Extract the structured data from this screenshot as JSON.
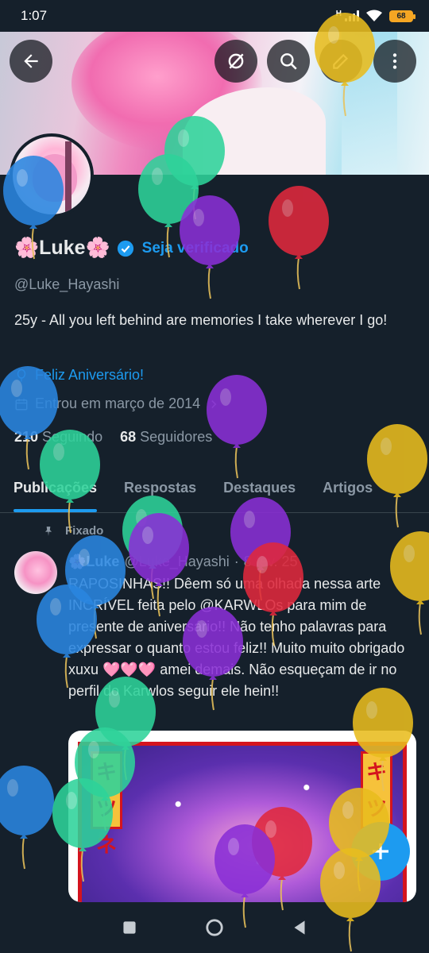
{
  "status_bar": {
    "time": "1:07",
    "network": "H",
    "battery": "68"
  },
  "header": {
    "back_icon": "arrow-left-icon",
    "actions": [
      "circle-slash-icon",
      "search-icon",
      "edit-icon",
      "more-vertical-icon"
    ]
  },
  "profile": {
    "name": "Luke",
    "name_decoration": "🌸",
    "verified_cta": "Seja verificado",
    "handle": "@Luke_Hayashi",
    "bio": "25y - All you left behind are memories I take wherever I go!",
    "birthday": "Feliz Aniversário!",
    "joined": "Entrou em março de 2014",
    "following_count": "210",
    "following_label": "Seguindo",
    "followers_count": "68",
    "followers_label": "Seguidores"
  },
  "tabs": [
    {
      "label": "Publicações",
      "active": true
    },
    {
      "label": "Respostas",
      "active": false
    },
    {
      "label": "Destaques",
      "active": false
    },
    {
      "label": "Artigos",
      "active": false
    }
  ],
  "pinned_post": {
    "pinned_label": "Fixado",
    "author_name": "Luke",
    "author_handle": "@Luke_Hayashi",
    "separator": "·",
    "date": "8 fev. 25",
    "text": "RAPOSINHAS!! Dêem só uma olhada nessa arte INCRÍVEL feita pelo @KARWLOs para mim de presente de aniversário!! Não tenho palavras para expressar o quanto estou feliz!! Muito muito obrigado xuxu 🩷🩷🩷 amei demais. Não esqueçam de ir no perfil do Karwlos seguir ele hein!!",
    "image_tags": [
      "キツネ",
      "キツネ"
    ]
  },
  "colors": {
    "background": "#15202b",
    "accent": "#1d9bf0",
    "text_primary": "#e7e9ea",
    "text_secondary": "#8b98a5"
  },
  "fab": {
    "icon": "plus-icon"
  },
  "nav_bar": {
    "icons": [
      "recents-square-icon",
      "home-circle-icon",
      "back-triangle-icon"
    ]
  },
  "overlay": {
    "type": "birthday-balloons",
    "balloon_colors": {
      "blue": "#2a86e0",
      "green": "#2ed39a",
      "purple": "#8a2fd6",
      "red": "#e0283d",
      "yellow": "#e9bd1e"
    }
  }
}
